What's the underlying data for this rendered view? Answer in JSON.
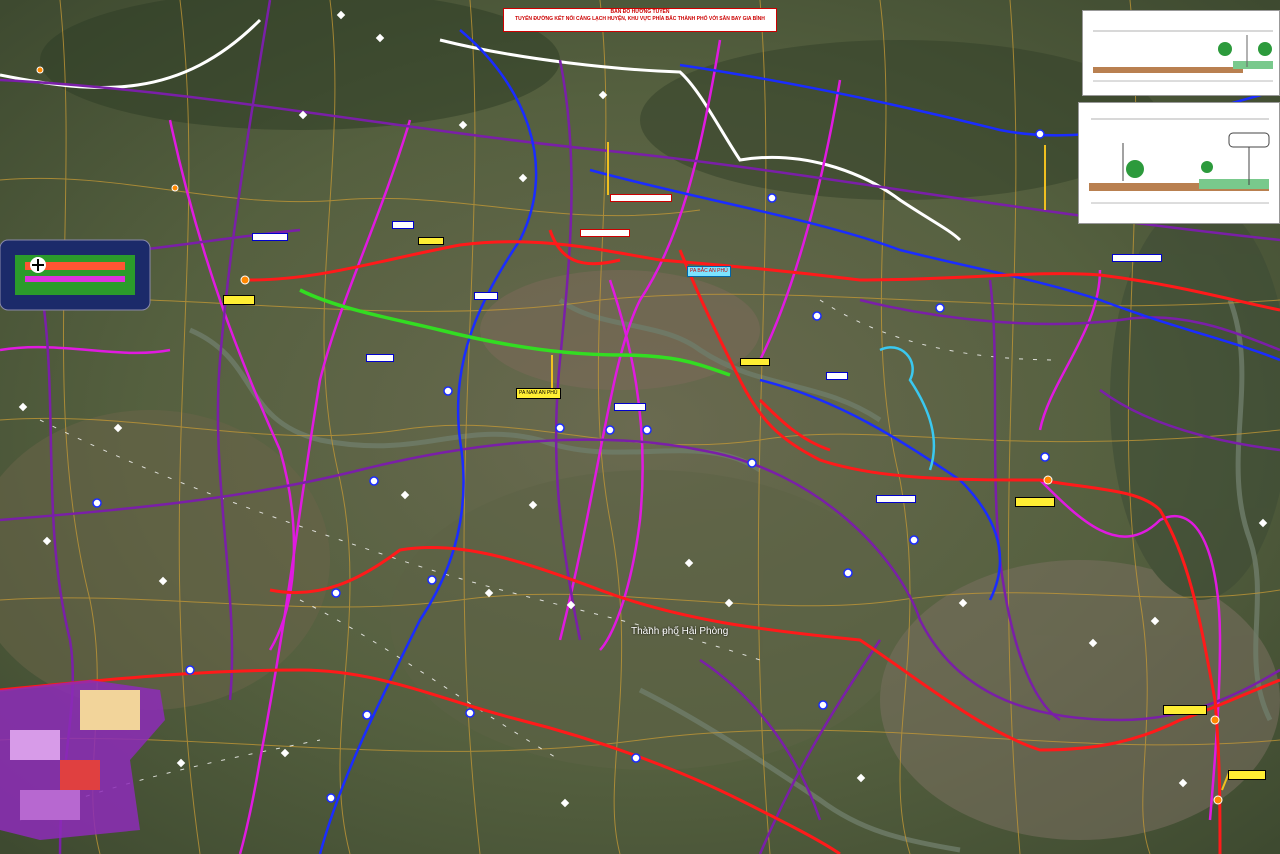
{
  "map": {
    "title_line1": "BẢN ĐỒ HƯỚNG TUYẾN",
    "title_line2": "TUYẾN ĐƯỜNG KẾT NỐI CẢNG LẠCH HUYỆN, KHU VỰC PHÍA BẮC THÀNH PHỐ VỚI SÂN BAY GIA BÌNH",
    "city_label": "Thành phố Hải Phòng",
    "zone_labels": {
      "bac_an_phu": "PA BẮC AN PHÚ",
      "nam_an_phu": "PA NAM AN PHÚ"
    },
    "colors": {
      "background": "#4d5a3a",
      "route_red": "#ff1a1a",
      "route_green": "#33dd22",
      "route_blue": "#1a2cff",
      "route_purple": "#7a1fa8",
      "route_magenta": "#e01ae0",
      "route_white": "#ffffff",
      "route_cyan": "#3ac8f0",
      "road_tan": "#c79a35"
    },
    "icons": [
      "airport-icon",
      "interchange-marker",
      "node-marker"
    ]
  }
}
